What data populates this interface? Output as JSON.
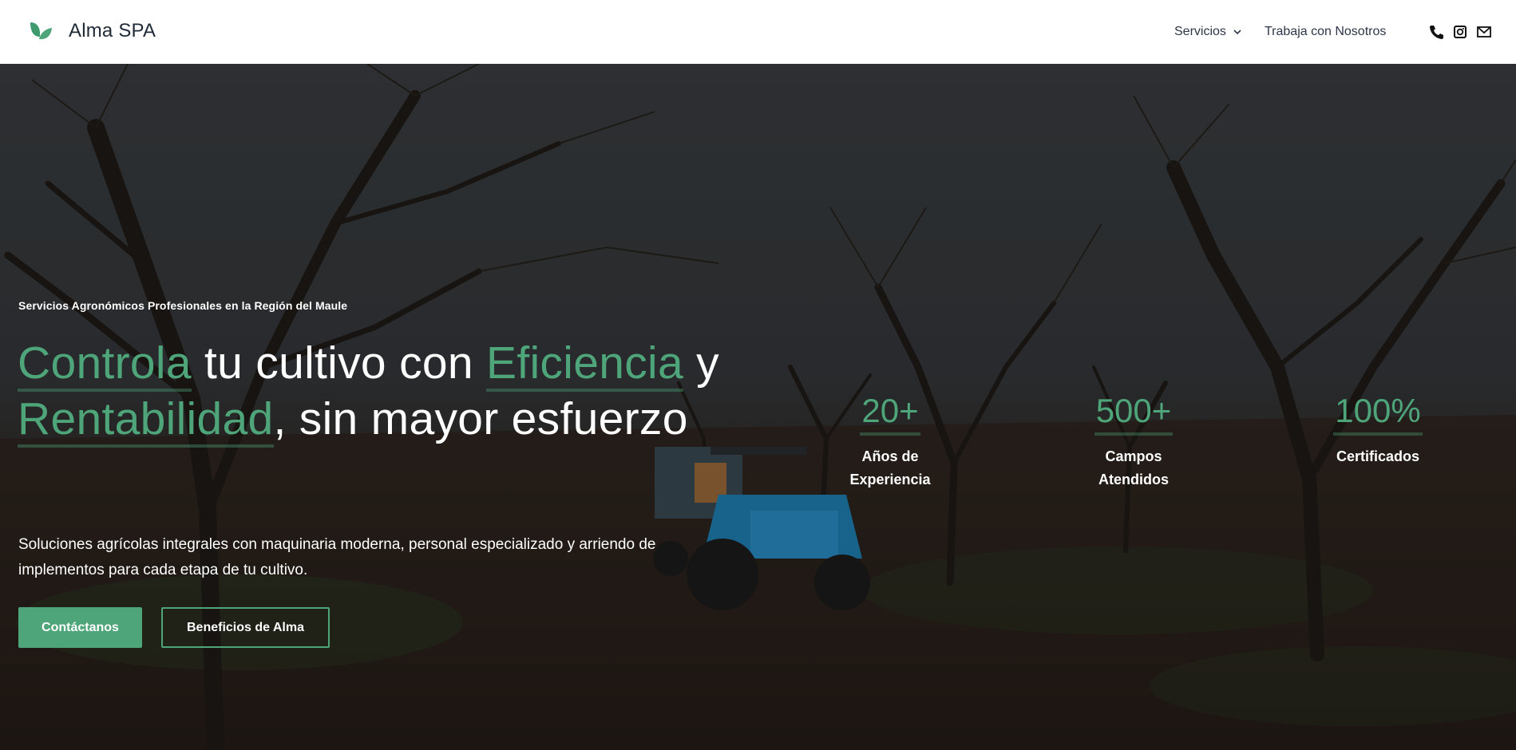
{
  "header": {
    "brand_name": "Alma SPA",
    "nav": {
      "services_label": "Servicios",
      "jobs_label": "Trabaja con Nosotros"
    },
    "icons": [
      "phone-icon",
      "instagram-icon",
      "mail-icon"
    ]
  },
  "hero": {
    "tagline": "Servicios Agronómicos Profesionales en la Región del Maule",
    "title": {
      "word1": "Controla",
      "text1": " tu cultivo con ",
      "word2": "Eficiencia",
      "text2": " y ",
      "word3": "Rentabilidad",
      "text3": ", sin mayor esfuerzo"
    },
    "description": "Soluciones agrícolas integrales con maquinaria moderna, personal especializado y arriendo de implementos para cada etapa de tu cultivo.",
    "buttons": {
      "primary": "Contáctanos",
      "secondary": "Beneficios de Alma"
    },
    "stats": [
      {
        "value": "20+",
        "label": "Años de Experiencia"
      },
      {
        "value": "500+",
        "label": "Campos Atendidos"
      },
      {
        "value": "100%",
        "label": "Certificados"
      }
    ]
  },
  "colors": {
    "accent": "#4fa57a",
    "header_bg": "#ffffff",
    "text_dark": "#1f2a37"
  }
}
